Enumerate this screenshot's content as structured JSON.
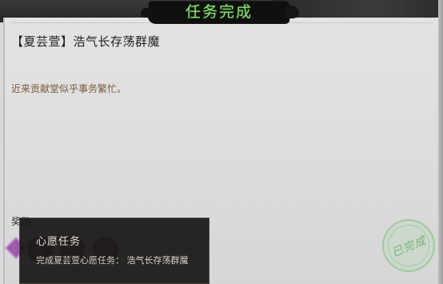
{
  "header": {
    "title": "任务完成"
  },
  "quest": {
    "title": "【夏芸萱】浩气长存荡群魔",
    "description": "近来贡献堂似乎事务繁忙。"
  },
  "rewards": {
    "label": "奖励"
  },
  "tooltip": {
    "title": "心愿任务",
    "body": "完成夏芸萱心愿任务： 浩气长存荡群魔"
  },
  "stamp": {
    "text": "已完成"
  },
  "colors": {
    "header_text": "#8fe07a",
    "description_text": "#7a5a3a",
    "stamp": "#78be78"
  }
}
